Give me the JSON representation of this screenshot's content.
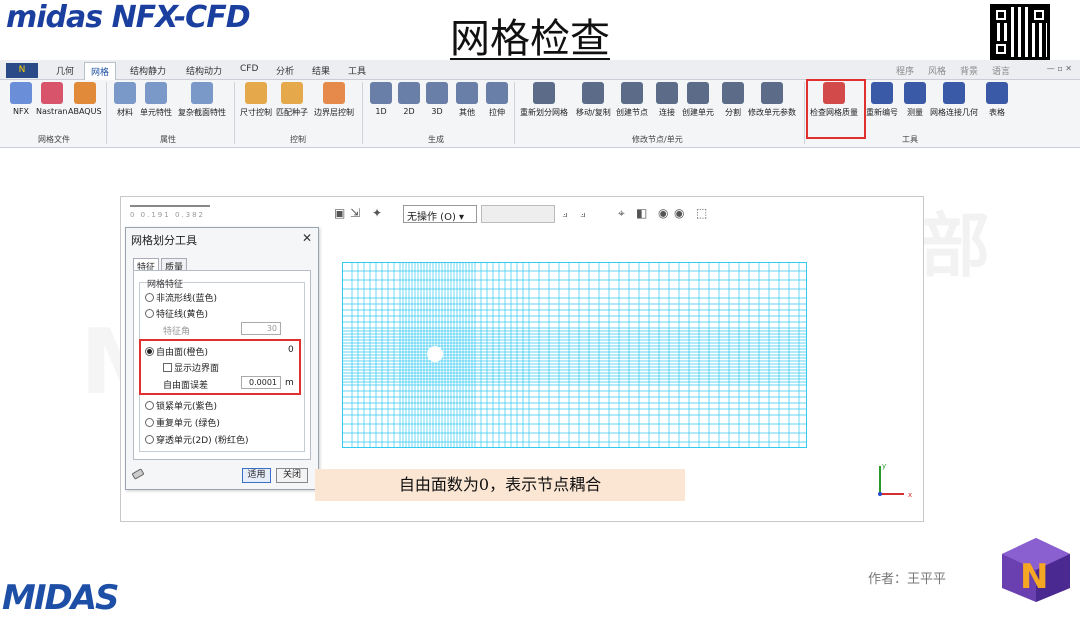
{
  "header": {
    "brand": "midas NFX-CFD",
    "title": "网格检查"
  },
  "ribbon": {
    "app_button": "N",
    "tabs": [
      "几何",
      "网格",
      "结构静力",
      "结构动力",
      "CFD",
      "分析",
      "结果",
      "工具"
    ],
    "active_tab": "网格",
    "right_menus": [
      "程序",
      "风格",
      "背景",
      "语言"
    ],
    "tools": [
      "NFX",
      "Nastran",
      "ABAQUS",
      "材料",
      "单元特性",
      "复杂截面特性",
      "尺寸控制",
      "匹配种子",
      "边界层控制",
      "1D",
      "2D",
      "3D",
      "其他",
      "拉伸",
      "重新划分网格",
      "移动/复制",
      "创建节点",
      "连接",
      "创建单元",
      "分割",
      "修改单元参数",
      "检查网格质量",
      "重新编号",
      "测量",
      "网格连接几何",
      "表格"
    ],
    "groups": [
      "网格文件",
      "属性",
      "控制",
      "生成",
      "修改节点/单元",
      "工具"
    ]
  },
  "canvas": {
    "scale_labels": "0    0.191   0.382",
    "operation_select": "无操作 (O)"
  },
  "dialog": {
    "title": "网格划分工具",
    "tabs": [
      "特征",
      "质量"
    ],
    "group_label": "网格特征",
    "opt_nonmanifold": "非流形线(蓝色)",
    "opt_feature": "特征线(黄色)",
    "feature_angle_label": "特征角",
    "feature_angle_value": "30",
    "opt_freeface": "自由面(橙色)",
    "freeface_count": "0",
    "chk_show_boundary": "显示边界面",
    "tolerance_label": "自由面误差",
    "tolerance_value": "0.0001",
    "tolerance_unit": "m",
    "opt_locked": "锁紧单元(紫色)",
    "opt_duplicate": "重复单元 (绿色)",
    "opt_pierce": "穿透单元(2D) (粉红色)",
    "apply": "适用",
    "close": "关闭"
  },
  "callout": "自由面数为0，表示节点耦合",
  "footer": {
    "logo": "MIDAS",
    "author": "作者：王平平"
  },
  "colors": {
    "mesh": "#33c9f0",
    "highlight": "#e03030",
    "callout_bg": "#fbe6d4",
    "brand": "#1a3f9e"
  }
}
